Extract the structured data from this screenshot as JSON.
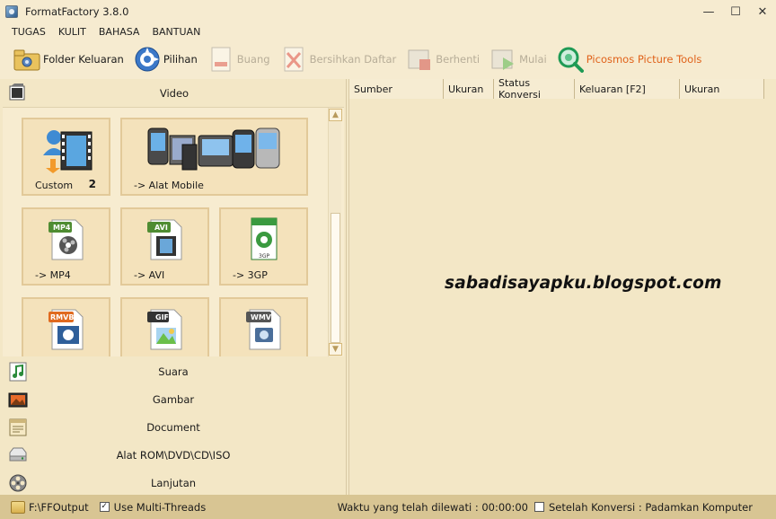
{
  "window": {
    "title": "FormatFactory 3.8.0",
    "minimize": "—",
    "maximize": "☐",
    "close": "✕"
  },
  "menu": [
    "TUGAS",
    "KULIT",
    "BAHASA",
    "BANTUAN"
  ],
  "toolbar": {
    "output_folder": "Folder Keluaran",
    "options": "Pilihan",
    "remove": "Buang",
    "clear_list": "Bersihkan Daftar",
    "stop": "Berhenti",
    "start": "Mulai",
    "picosmos": "Picosmos Picture Tools"
  },
  "left": {
    "video_header": "Video",
    "tiles": {
      "custom": {
        "label": "Custom",
        "badge": "2"
      },
      "mobile": {
        "label": "-> Alat Mobile"
      },
      "mp4": {
        "label": "-> MP4",
        "tag": "MP4"
      },
      "avi": {
        "label": "-> AVI",
        "tag": "AVI"
      },
      "gp3": {
        "label": "-> 3GP",
        "tag": "3GP"
      },
      "rmvb": {
        "tag": "RMVB"
      },
      "gif": {
        "tag": "GIF"
      },
      "wmv": {
        "tag": "WMV"
      }
    },
    "categories": [
      "Suara",
      "Gambar",
      "Document",
      "Alat ROM\\DVD\\CD\\ISO",
      "Lanjutan"
    ]
  },
  "list": {
    "columns": [
      "Sumber",
      "Ukuran",
      "Status Konversi",
      "Keluaran [F2]",
      "Ukuran"
    ]
  },
  "watermark": "sabadisayapku.blogspot.com",
  "status": {
    "output_path": "F:\\FFOutput",
    "multi_threads": "Use Multi-Threads",
    "multi_threads_checked": true,
    "elapsed": "Waktu yang telah dilewati : 00:00:00",
    "after_convert": "Setelah Konversi : Padamkan Komputer",
    "after_convert_checked": false
  },
  "colors": {
    "panel": "#f3e7c6",
    "tile_bg": "#f4e2bb",
    "statusbar": "#d8c593",
    "accent_orange": "#e0621a"
  }
}
